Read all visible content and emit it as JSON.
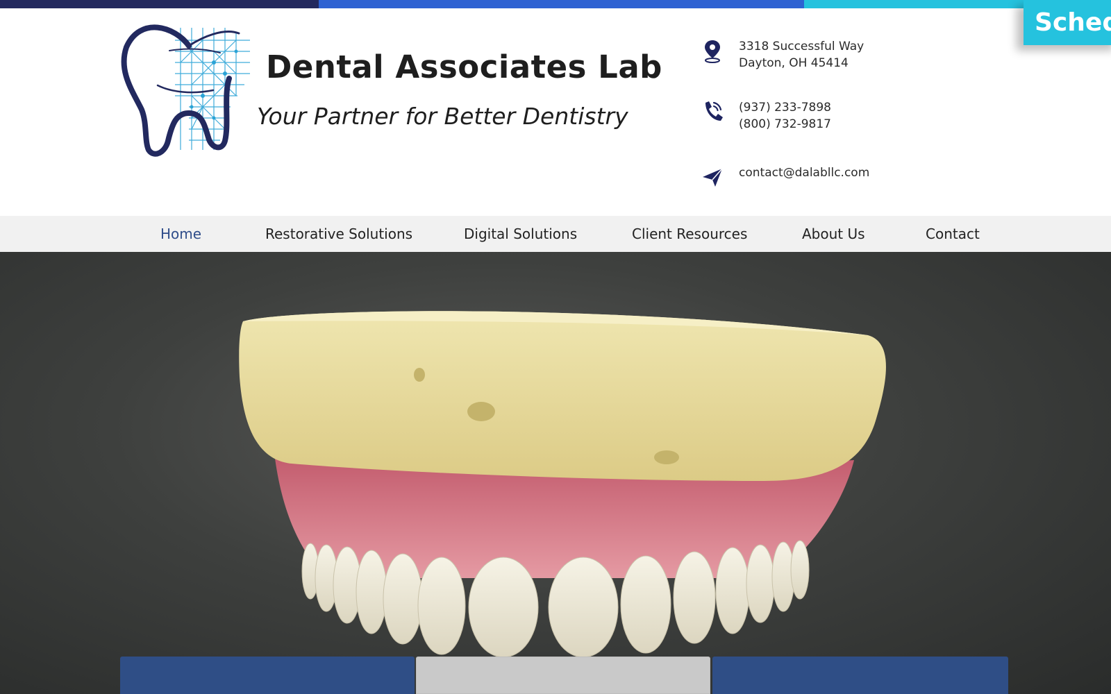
{
  "header": {
    "schedule_label": "Sched",
    "brand_title": "Dental Associates Lab",
    "tagline": "Your Partner for Better Dentistry"
  },
  "contact": {
    "address_line1": "3318 Successful Way",
    "address_line2": "Dayton, OH 45414",
    "phone1": "(937) 233-7898",
    "phone2": "(800) 732-9817",
    "email": "contact@dalabllc.com"
  },
  "nav": {
    "items": [
      {
        "label": "Home",
        "active": true
      },
      {
        "label": "Restorative Solutions"
      },
      {
        "label": "Digital Solutions"
      },
      {
        "label": "Client Resources"
      },
      {
        "label": "About Us"
      },
      {
        "label": "Contact"
      }
    ]
  },
  "colors": {
    "navy": "#23295e",
    "blue": "#2e62d2",
    "cyan": "#25c2de",
    "card_blue": "#2f4e86",
    "nav_active": "#2f4d8a"
  },
  "icons": [
    "map-pin-icon",
    "phone-icon",
    "paper-plane-icon"
  ]
}
